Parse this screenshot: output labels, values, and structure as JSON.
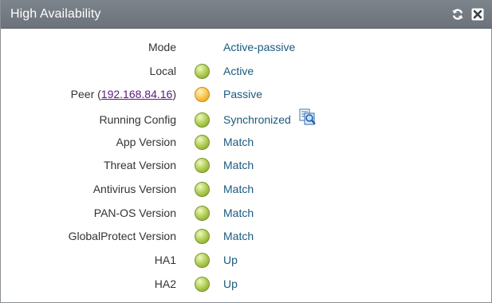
{
  "window": {
    "title": "High Availability",
    "refresh_icon": "refresh-icon",
    "close_icon": "close-icon"
  },
  "rows": {
    "mode": {
      "label": "Mode",
      "value": "Active-passive"
    },
    "local": {
      "label": "Local",
      "status": "green",
      "value": "Active"
    },
    "peer": {
      "label_prefix": "Peer (",
      "ip": "192.168.84.16",
      "label_suffix": ")",
      "status": "yellow",
      "value": "Passive"
    },
    "running_config": {
      "label": "Running Config",
      "status": "green",
      "value": "Synchronized",
      "icon": "compare-config-icon"
    },
    "app_version": {
      "label": "App Version",
      "status": "green",
      "value": "Match"
    },
    "threat_version": {
      "label": "Threat Version",
      "status": "green",
      "value": "Match"
    },
    "antivirus_version": {
      "label": "Antivirus Version",
      "status": "green",
      "value": "Match"
    },
    "panos_version": {
      "label": "PAN-OS Version",
      "status": "green",
      "value": "Match"
    },
    "globalprotect_version": {
      "label": "GlobalProtect Version",
      "status": "green",
      "value": "Match"
    },
    "ha1": {
      "label": "HA1",
      "status": "green",
      "value": "Up"
    },
    "ha2": {
      "label": "HA2",
      "status": "green",
      "value": "Up"
    }
  },
  "colors": {
    "titlebar": "#737a82",
    "value_text": "#1a5a7e",
    "label_text": "#333333",
    "link": "#5b1a7a",
    "status_green": "#a6c246",
    "status_yellow": "#f5b73a"
  }
}
